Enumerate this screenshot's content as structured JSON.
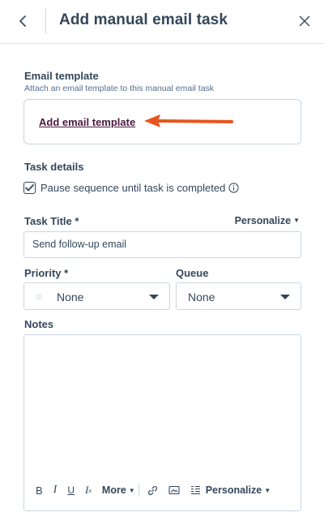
{
  "header": {
    "title": "Add manual email task"
  },
  "email_template": {
    "label": "Email template",
    "helper": "Attach an email template to this manual email task",
    "link_label": "Add email template"
  },
  "task_details": {
    "label": "Task details",
    "checkbox_label": "Pause sequence until task is completed",
    "checkbox_checked": true
  },
  "task_title": {
    "label": "Task Title *",
    "personalize_label": "Personalize",
    "value": "Send follow-up email"
  },
  "priority": {
    "label": "Priority *",
    "value": "None"
  },
  "queue": {
    "label": "Queue",
    "value": "None"
  },
  "notes": {
    "label": "Notes",
    "toolbar": {
      "bold": "B",
      "italic": "I",
      "underline": "U",
      "clear_format": "Ix",
      "more_label": "More",
      "personalize_label": "Personalize"
    }
  },
  "colors": {
    "text": "#33475b",
    "border": "#cbd6e2",
    "link": "#4a1a3f",
    "annotation_arrow": "#e8541e"
  },
  "icons": [
    "chevron-left-icon",
    "close-icon",
    "checkmark-icon",
    "info-icon",
    "link-icon",
    "image-icon",
    "format-align-icon",
    "caret-down-icon"
  ]
}
